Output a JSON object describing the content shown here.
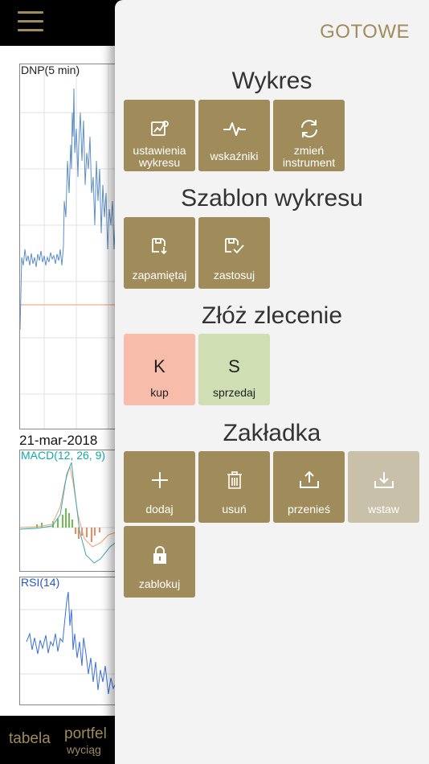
{
  "chart": {
    "main_label": "DNP(5 min)",
    "date_label": "21-mar-2018",
    "macd_label": "MACD(12, 26, 9)",
    "rsi_label": "RSI(14)"
  },
  "bottom_nav": {
    "tabela": "tabela",
    "portfel": "portfel",
    "wyciag": "wyciąg"
  },
  "panel": {
    "done_label": "GOTOWE",
    "sections": {
      "wykres": {
        "title": "Wykres",
        "tiles": [
          {
            "label1": "ustawienia",
            "label2": "wykresu",
            "icon": "chart-settings-icon"
          },
          {
            "label1": "wskaźniki",
            "label2": "",
            "icon": "pulse-icon"
          },
          {
            "label1": "zmień",
            "label2": "instrument",
            "icon": "refresh-icon"
          }
        ]
      },
      "szablon": {
        "title": "Szablon wykresu",
        "tiles": [
          {
            "label1": "zapamiętaj",
            "icon": "save-icon"
          },
          {
            "label1": "zastosuj",
            "icon": "save-check-icon"
          }
        ]
      },
      "zlecenie": {
        "title": "Złóż zlecenie",
        "tiles": [
          {
            "letter": "K",
            "label1": "kup",
            "color": "#f8bcaa"
          },
          {
            "letter": "S",
            "label1": "sprzedaj",
            "color": "#cfdfb3"
          }
        ]
      },
      "zakladka": {
        "title": "Zakładka",
        "tiles": [
          {
            "label1": "dodaj",
            "icon": "plus-icon"
          },
          {
            "label1": "usuń",
            "icon": "trash-icon"
          },
          {
            "label1": "przenieś",
            "icon": "upload-icon"
          },
          {
            "label1": "wstaw",
            "icon": "download-icon"
          },
          {
            "label1": "zablokuj",
            "icon": "lock-icon"
          }
        ]
      }
    }
  },
  "colors": {
    "accent": "#a08c5b",
    "accent_disabled": "#c9c0a9",
    "buy": "#f8bcaa",
    "sell": "#cfdfb3",
    "panel_bg": "#f3f3f3"
  }
}
